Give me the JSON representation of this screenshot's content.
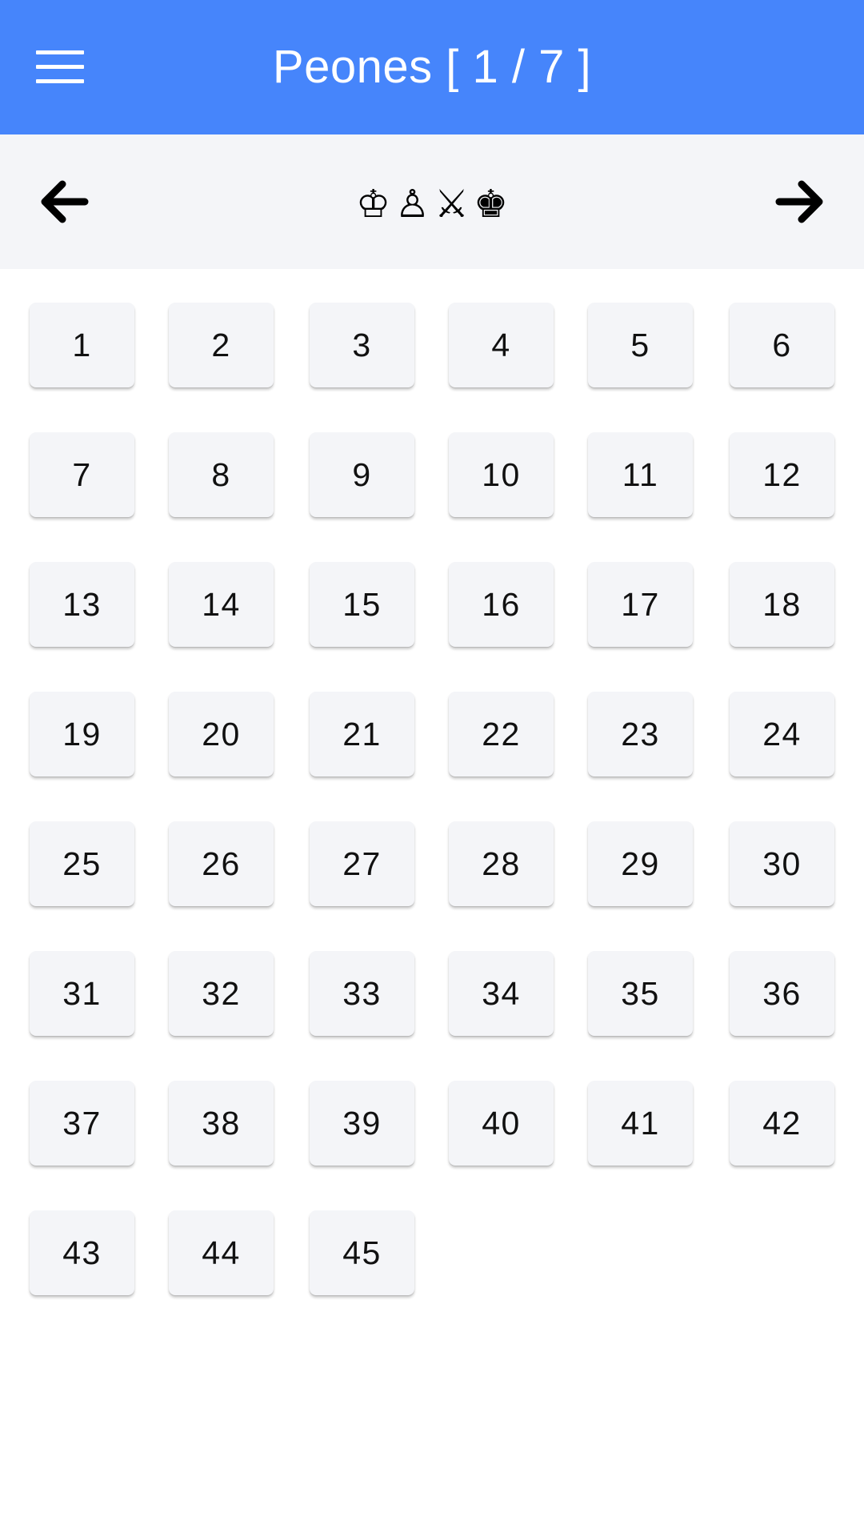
{
  "header": {
    "title": "Peones [ 1 / 7 ]",
    "background_color": "#4685fb",
    "menu_icon": "hamburger-menu-icon"
  },
  "nav": {
    "prev_icon": "arrow-left-icon",
    "next_icon": "arrow-right-icon",
    "pieces": [
      "♔",
      "♙",
      "⚔",
      "♚"
    ]
  },
  "levels": [
    "1",
    "2",
    "3",
    "4",
    "5",
    "6",
    "7",
    "8",
    "9",
    "10",
    "11",
    "12",
    "13",
    "14",
    "15",
    "16",
    "17",
    "18",
    "19",
    "20",
    "21",
    "22",
    "23",
    "24",
    "25",
    "26",
    "27",
    "28",
    "29",
    "30",
    "31",
    "32",
    "33",
    "34",
    "35",
    "36",
    "37",
    "38",
    "39",
    "40",
    "41",
    "42",
    "43",
    "44",
    "45"
  ]
}
